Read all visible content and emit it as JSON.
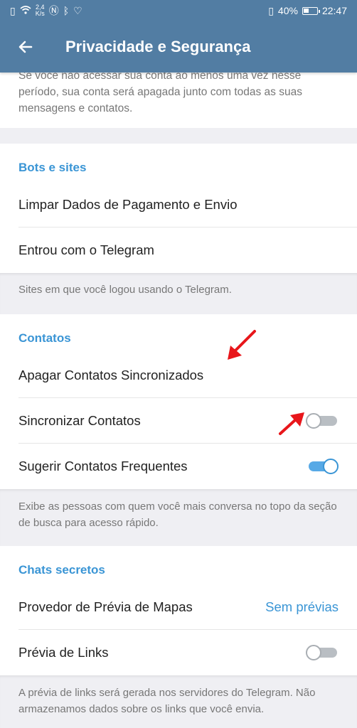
{
  "status": {
    "speed_value": "2,4",
    "speed_unit": "K/s",
    "battery": "40%",
    "time": "22:47"
  },
  "appbar": {
    "title": "Privacidade e Segurança"
  },
  "top_note": "Se você não acessar sua conta ao menos uma vez nesse período, sua conta será apagada junto com todas as suas mensagens e contatos.",
  "bots": {
    "title": "Bots e sites",
    "items": [
      "Limpar Dados de Pagamento e Envio",
      "Entrou com o Telegram"
    ],
    "hint": "Sites em que você logou usando o Telegram."
  },
  "contacts": {
    "title": "Contatos",
    "delete_label": "Apagar Contatos Sincronizados",
    "sync_label": "Sincronizar Contatos",
    "sync_on": false,
    "suggest_label": "Sugerir Contatos Frequentes",
    "suggest_on": true,
    "hint": "Exibe as pessoas com quem você mais conversa no topo da seção de busca para acesso rápido."
  },
  "secret": {
    "title": "Chats secretos",
    "maps_label": "Provedor de Prévia de Mapas",
    "maps_value": "Sem prévias",
    "links_label": "Prévia de Links",
    "links_on": false,
    "hint": "A prévia de links será gerada nos servidores do Telegram. Não armazenamos dados sobre os links que você envia."
  },
  "colors": {
    "bar": "#527da3",
    "accent": "#3a95d5",
    "arrow": "#e8161b"
  }
}
